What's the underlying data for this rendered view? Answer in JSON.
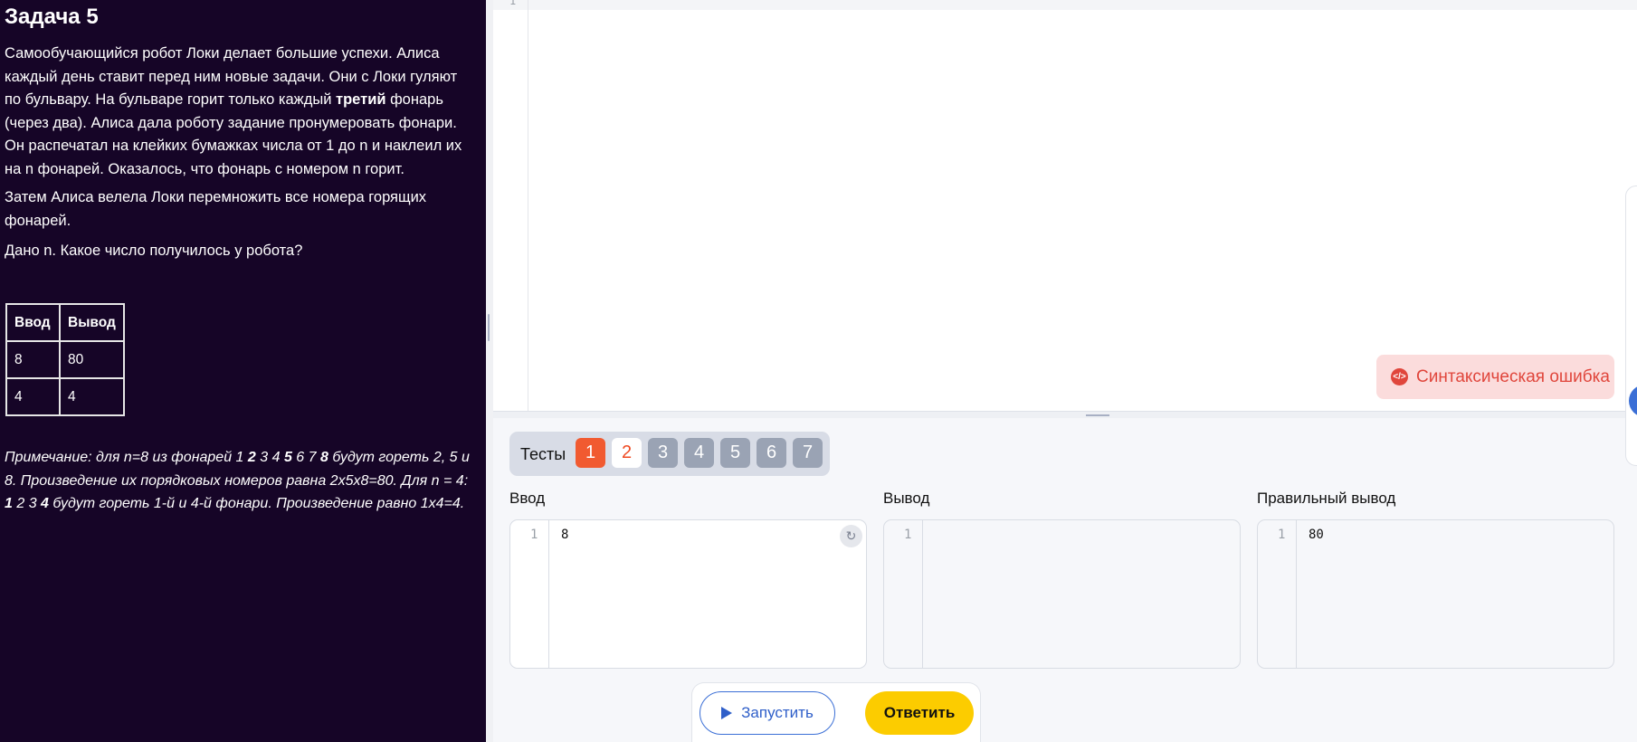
{
  "task": {
    "title": "Задача 5",
    "p1_a": "Самообучающийся робот Локи делает большие успехи. Алиса каждый день ставит перед ним новые задачи. Они с Локи гуляют по бульвару. На бульваре горит только каждый ",
    "p1_bold": "третий",
    "p1_b": " фонарь (через два). Алиса дала роботу задание пронумеровать фонари. Он распечатал на клейких бумажках числа от 1 до n и наклеил их на n фонарей. Оказалось, что фонарь с номером n горит.",
    "p2": "Затем Алиса велела Локи перемножить все номера горящих фонарей.",
    "p3": "Дано n. Какое число получилось у робота?",
    "table": {
      "headers": [
        "Ввод",
        "Вывод"
      ],
      "rows": [
        [
          "8",
          "80"
        ],
        [
          "4",
          "4"
        ]
      ]
    },
    "note": {
      "s1": "Примечание: для n=8 из фонарей 1 ",
      "b1": "2",
      "s2": " 3 4 ",
      "b2": "5",
      "s3": " 6 7 ",
      "b3": "8",
      "s4": " будут гореть 2,  5 и 8. Произведение их порядковых номеров равна 2x5x8=80. Для n = 4: ",
      "b4": "1",
      "s5": " 2 3 ",
      "b5": "4",
      "s6": " будут гореть 1-й и 4-й фонари. Произведение равно 1х4=4."
    }
  },
  "editor": {
    "line_number": "1",
    "syntax_error_label": "Синтаксическая ошибка",
    "syntax_error_icon": "code-icon"
  },
  "tests": {
    "label": "Тесты",
    "items": [
      "1",
      "2",
      "3",
      "4",
      "5",
      "6",
      "7"
    ],
    "active": "1"
  },
  "io": {
    "input_label": "Ввод",
    "output_label": "Вывод",
    "expected_label": "Правильный вывод",
    "input_line": "1",
    "input_value": "8",
    "output_line": "1",
    "output_value": "",
    "expected_line": "1",
    "expected_value": "80",
    "reset_icon": "refresh-icon"
  },
  "actions": {
    "run_label": "Запустить",
    "answer_label": "Ответить"
  },
  "colors": {
    "panel_bg": "#160527",
    "accent_orange": "#f15a30",
    "answer_yellow": "#fccc00",
    "run_blue": "#2f5fc9",
    "error_red": "#e0463c"
  }
}
